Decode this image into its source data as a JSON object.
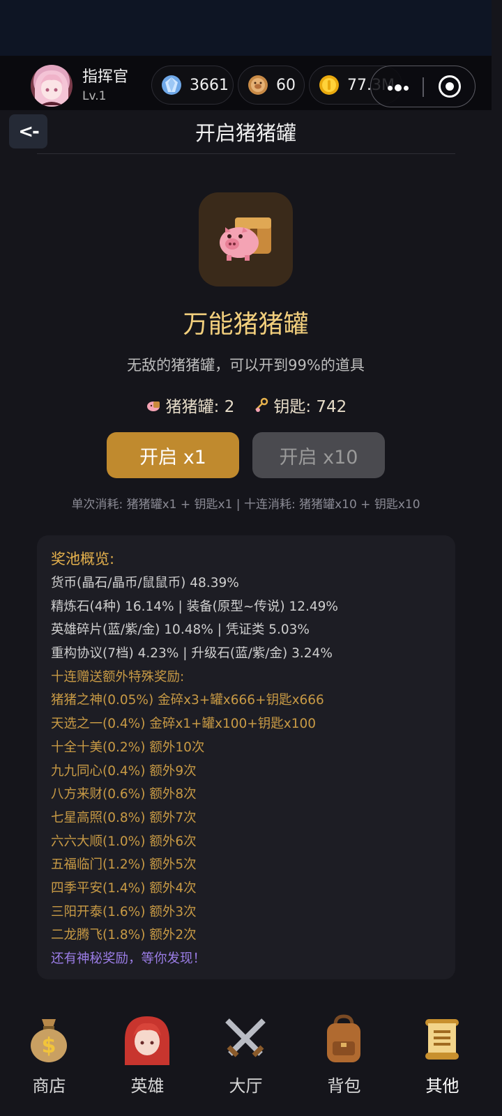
{
  "header": {
    "player_name": "指挥官",
    "player_level": "Lv.1",
    "currencies": [
      {
        "icon": "diamond-icon",
        "value": "3661"
      },
      {
        "icon": "pig-coin-icon",
        "value": "60"
      },
      {
        "icon": "gold-coin-icon",
        "value": "77.3M"
      }
    ]
  },
  "page": {
    "back_label": "<-",
    "title": "开启猪猪罐"
  },
  "item": {
    "icon": "piggy-chest-icon",
    "name": "万能猪猪罐",
    "description": "无敌的猪猪罐，可以开到99%的道具",
    "jar_count_label": "猪猪罐: 2",
    "key_count_label": "钥匙: 742"
  },
  "actions": {
    "open_one_label": "开启 x1",
    "open_ten_label": "开启 x10",
    "cost_note": "单次消耗: 猪猪罐x1 + 钥匙x1 | 十连消耗: 猪猪罐x10 + 钥匙x10"
  },
  "pool": {
    "title": "奖池概览:",
    "lines": [
      "货币(晶石/晶币/鼠鼠币) 48.39%",
      "精炼石(4种) 16.14% | 装备(原型~传说) 12.49%",
      "英雄碎片(蓝/紫/金) 10.48% | 凭证类 5.03%",
      "重构协议(7档) 4.23% | 升级石(蓝/紫/金) 3.24%",
      "十连赠送额外特殊奖励:",
      "猪猪之神(0.05%) 金碎x3+罐x666+钥匙x666",
      "天选之一(0.4%) 金碎x1+罐x100+钥匙x100",
      "十全十美(0.2%) 额外10次",
      "九九同心(0.4%) 额外9次",
      "八方来财(0.6%) 额外8次",
      "七星高照(0.8%) 额外7次",
      "六六大顺(1.0%) 额外6次",
      "五福临门(1.2%) 额外5次",
      "四季平安(1.4%) 额外4次",
      "三阳开泰(1.6%) 额外3次",
      "二龙腾飞(1.8%) 额外2次",
      "还有神秘奖励，等你发现！"
    ]
  },
  "tabbar": {
    "tabs": [
      {
        "label": "商店",
        "icon": "money-bag-icon"
      },
      {
        "label": "英雄",
        "icon": "hero-portrait-icon"
      },
      {
        "label": "大厅",
        "icon": "crossed-swords-icon"
      },
      {
        "label": "背包",
        "icon": "backpack-icon"
      },
      {
        "label": "其他",
        "icon": "scroll-icon"
      }
    ],
    "active_index": 4
  },
  "colors": {
    "accent_gold": "#c08a2e",
    "title_gold": "#f2cf7d",
    "reward_gold": "#c89a45",
    "mystery_purple": "#9b7de6"
  }
}
